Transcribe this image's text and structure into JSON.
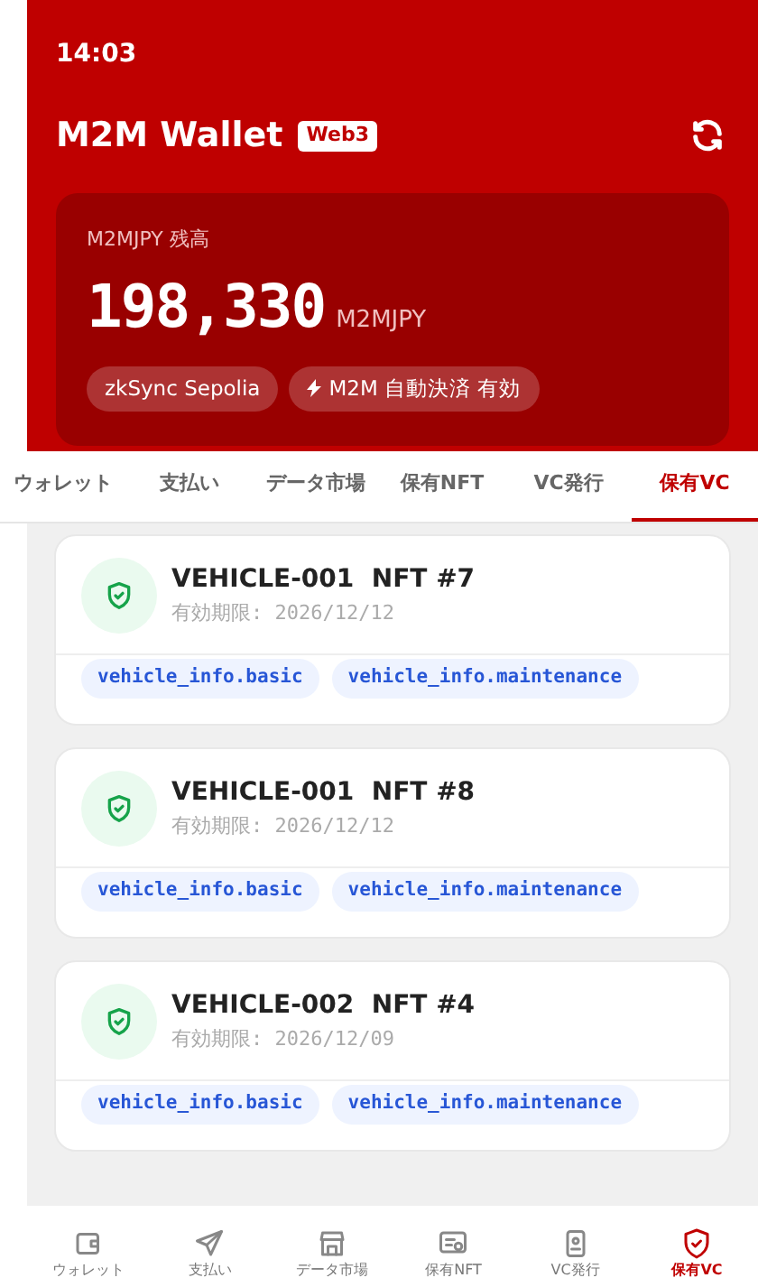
{
  "status_bar": {
    "time": "14:03"
  },
  "header": {
    "title": "M2M Wallet",
    "badge": "Web3"
  },
  "balance": {
    "label": "M2MJPY 残高",
    "amount": "198,330",
    "unit": "M2MJPY",
    "chips": [
      {
        "kind": "plain",
        "text": "zkSync Sepolia"
      },
      {
        "kind": "bolt",
        "text": "M2M 自動決済 有効"
      }
    ]
  },
  "tabs": [
    {
      "label": "ウォレット",
      "selected": false
    },
    {
      "label": "支払い",
      "selected": false
    },
    {
      "label": "データ市場",
      "selected": false
    },
    {
      "label": "保有NFT",
      "selected": false
    },
    {
      "label": "VC発行",
      "selected": false
    },
    {
      "label": "保有VC",
      "selected": true
    }
  ],
  "credentials": [
    {
      "title": "VEHICLE-001  NFT #7",
      "expiry": "有効期限: 2026/12/12",
      "scopes": [
        "vehicle_info.basic",
        "vehicle_info.maintenance"
      ]
    },
    {
      "title": "VEHICLE-001  NFT #8",
      "expiry": "有効期限: 2026/12/12",
      "scopes": [
        "vehicle_info.basic",
        "vehicle_info.maintenance"
      ]
    },
    {
      "title": "VEHICLE-002  NFT #4",
      "expiry": "有効期限: 2026/12/09",
      "scopes": [
        "vehicle_info.basic",
        "vehicle_info.maintenance"
      ]
    }
  ],
  "bottom_nav": [
    {
      "kind": "wallet",
      "label": "ウォレット",
      "selected": false
    },
    {
      "kind": "send",
      "label": "支払い",
      "selected": false
    },
    {
      "kind": "store",
      "label": "データ市場",
      "selected": false
    },
    {
      "kind": "certificate",
      "label": "保有NFT",
      "selected": false
    },
    {
      "kind": "idcard",
      "label": "VC発行",
      "selected": false
    },
    {
      "kind": "shield",
      "label": "保有VC",
      "selected": true
    }
  ]
}
